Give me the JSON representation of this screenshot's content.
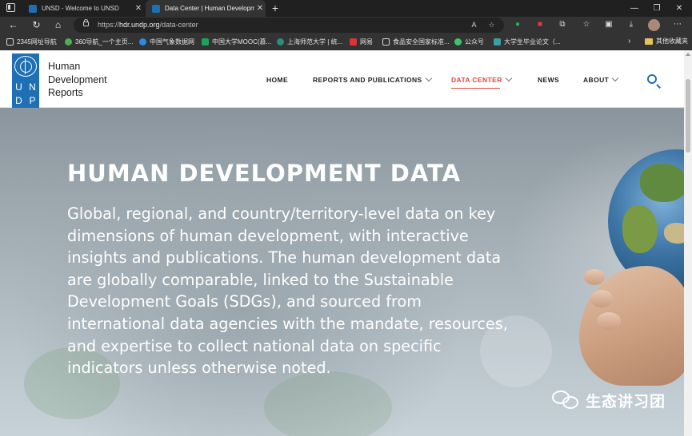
{
  "browser": {
    "tabs": [
      {
        "title": "UNSD - Welcome to UNSD",
        "active": false,
        "favicon_color": "#1f6fb5"
      },
      {
        "title": "Data Center | Human Developme",
        "active": true,
        "favicon_color": "#1f6fb5"
      }
    ],
    "new_tab_label": "+",
    "window_controls": {
      "minimize": "—",
      "restore": "❐",
      "close": "✕"
    },
    "nav": {
      "back": "←",
      "refresh": "↻",
      "home": "⌂"
    },
    "address": {
      "scheme": "https://",
      "host": "hdr.undp.org",
      "path": "/data-center"
    },
    "bookmarks": [
      {
        "label": "2345网址导航",
        "color": "#d8d8d8"
      },
      {
        "label": "360导航_一个主页...",
        "color": "#4caf50"
      },
      {
        "label": "中国气象数据网",
        "color": "#2b8be0"
      },
      {
        "label": "中国大学MOOC(慕...",
        "color": "#1aa35a"
      },
      {
        "label": "上海师范大学 | 统...",
        "color": "#2e8b80"
      },
      {
        "label": "网易",
        "color": "#d33"
      },
      {
        "label": "食品安全国家标准...",
        "color": "#d8d8d8"
      },
      {
        "label": "公众号",
        "color": "#3ec46d"
      },
      {
        "label": "大学生毕业论文（...",
        "color": "#3aa0a0"
      }
    ],
    "bookmarks_more": "›",
    "other_bookmarks": "其他收藏夹"
  },
  "site": {
    "logo_letters": [
      "U",
      "N",
      "D",
      "P"
    ],
    "brand_lines": [
      "Human",
      "Development",
      "Reports"
    ],
    "nav": [
      {
        "label": "HOME",
        "has_dropdown": false,
        "active": false
      },
      {
        "label": "REPORTS AND PUBLICATIONS",
        "has_dropdown": true,
        "active": false
      },
      {
        "label": "DATA CENTER",
        "has_dropdown": true,
        "active": true
      },
      {
        "label": "NEWS",
        "has_dropdown": false,
        "active": false
      },
      {
        "label": "ABOUT",
        "has_dropdown": true,
        "active": false
      }
    ],
    "accent_color": "#e0473d",
    "brand_color": "#1f6fb5"
  },
  "hero": {
    "title": "HUMAN DEVELOPMENT DATA",
    "text": "Global, regional, and country/territory-level data on key dimensions of human development, with interactive insights and publications. The human development data are globally comparable, linked to the Sustainable Development Goals (SDGs), and sourced from international data agencies with the mandate, resources, and expertise to collect national data on specific indicators unless otherwise noted."
  },
  "watermark": {
    "text": "生态讲习团"
  }
}
